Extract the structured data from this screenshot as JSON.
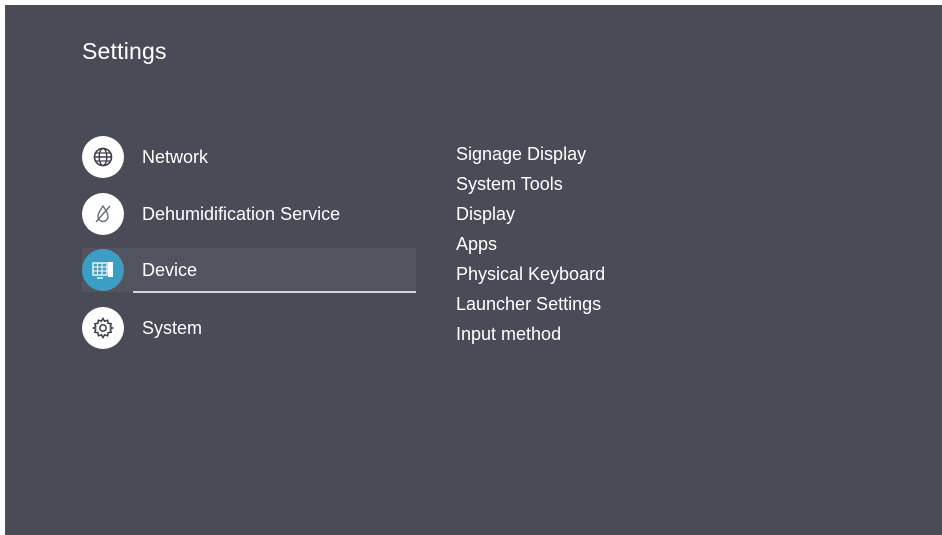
{
  "header": {
    "title": "Settings"
  },
  "menu": {
    "items": [
      {
        "label": "Network",
        "icon": "globe-icon"
      },
      {
        "label": "Dehumidification Service",
        "icon": "no-moisture-icon"
      },
      {
        "label": "Device",
        "icon": "device-display-icon",
        "selected": true
      },
      {
        "label": "System",
        "icon": "gear-icon"
      }
    ]
  },
  "submenu": {
    "items": [
      "Signage Display",
      "System Tools",
      "Display",
      "Apps",
      "Physical Keyboard",
      "Launcher Settings",
      "Input method"
    ]
  },
  "colors": {
    "background": "#494b56",
    "selected_row": "#52545f",
    "accent": "#3d9ec3",
    "text": "#ffffff"
  }
}
